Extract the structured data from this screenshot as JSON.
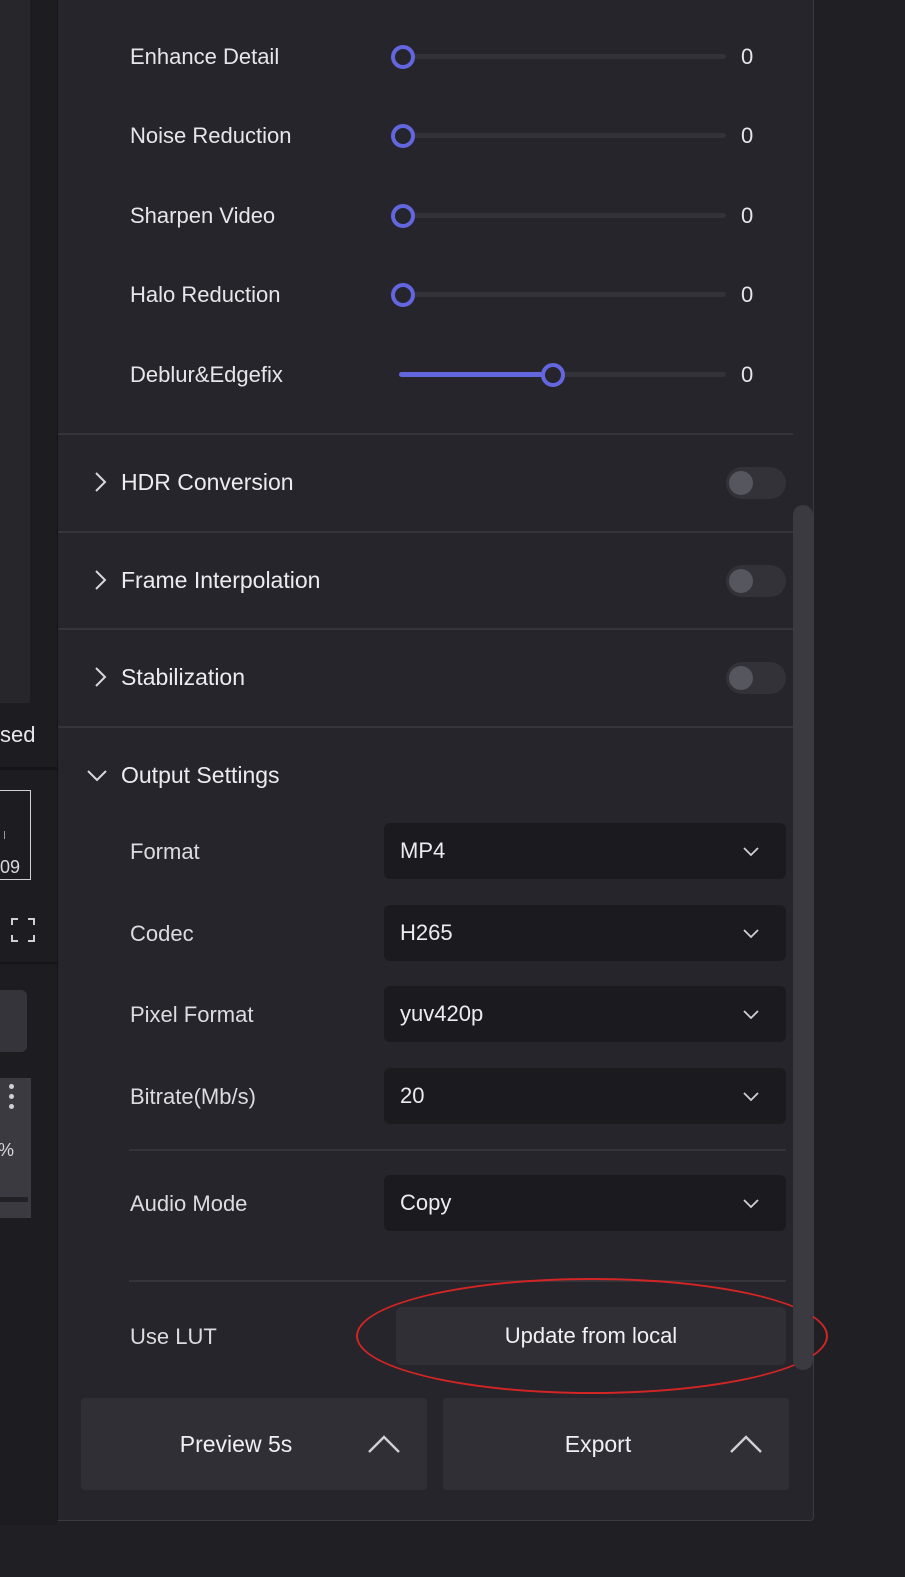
{
  "left_pane": {
    "status_text": "sed",
    "timecode": "09",
    "percent": "%"
  },
  "sliders": [
    {
      "label": "Enhance Detail",
      "value": "0",
      "position": 0.0
    },
    {
      "label": "Noise Reduction",
      "value": "0",
      "position": 0.0
    },
    {
      "label": "Sharpen Video",
      "value": "0",
      "position": 0.0
    },
    {
      "label": "Halo Reduction",
      "value": "0",
      "position": 0.0
    },
    {
      "label": "Deblur&Edgefix",
      "value": "0",
      "position": 0.47
    }
  ],
  "sections": {
    "hdr": {
      "title": "HDR Conversion",
      "enabled": false
    },
    "frame": {
      "title": "Frame Interpolation",
      "enabled": false
    },
    "stab": {
      "title": "Stabilization",
      "enabled": false
    },
    "output": {
      "title": "Output Settings",
      "expanded": true
    }
  },
  "output": {
    "format": {
      "label": "Format",
      "value": "MP4"
    },
    "codec": {
      "label": "Codec",
      "value": "H265"
    },
    "pixel_format": {
      "label": "Pixel Format",
      "value": "yuv420p"
    },
    "bitrate": {
      "label": "Bitrate(Mb/s)",
      "value": "20"
    },
    "audio_mode": {
      "label": "Audio Mode",
      "value": "Copy"
    },
    "lut": {
      "label": "Use LUT",
      "button": "Update from local"
    }
  },
  "actions": {
    "preview": "Preview 5s",
    "export": "Export"
  },
  "colors": {
    "accent": "#6466e0",
    "annotation": "#d42525"
  }
}
